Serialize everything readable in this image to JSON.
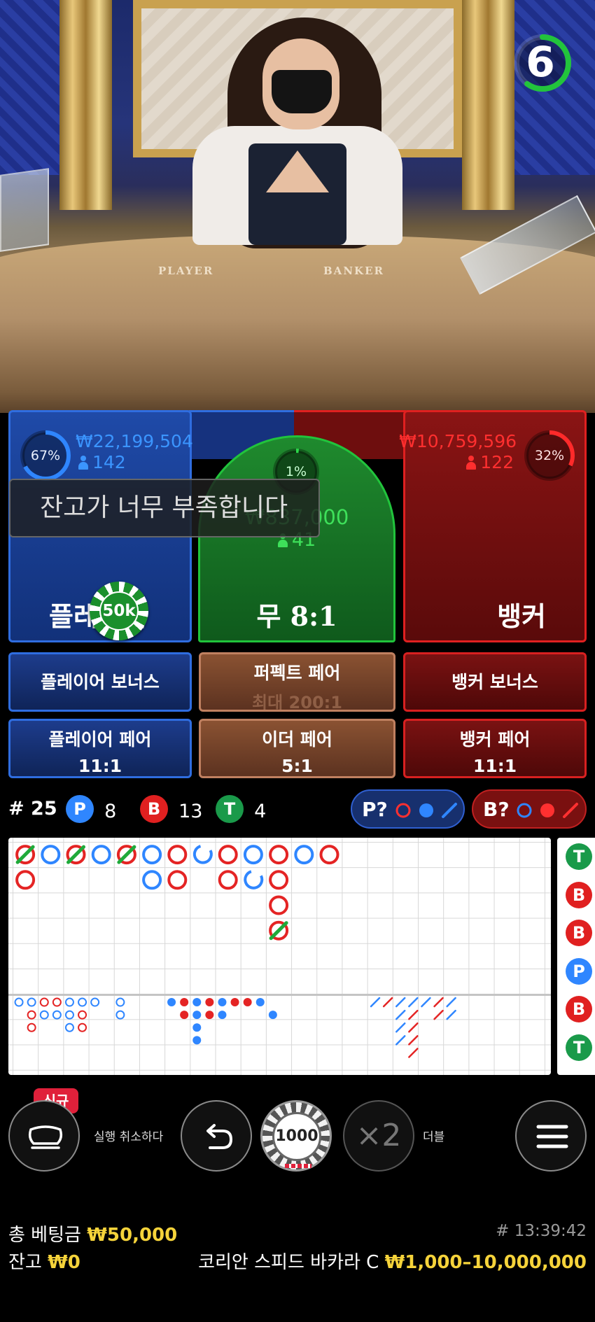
{
  "timer": {
    "seconds": "6",
    "progress": 0.6,
    "color": "#22c43c"
  },
  "table_words": {
    "player": "PLAYER",
    "banker": "BANKER"
  },
  "player": {
    "percent": "67%",
    "percent_value": 0.67,
    "amount": "₩22,199,504",
    "count": "142",
    "label": "플레이어",
    "color": "#2f86ff"
  },
  "banker": {
    "percent": "32%",
    "percent_value": 0.32,
    "amount": "₩10,759,596",
    "count": "122",
    "label": "뱅커",
    "color": "#ff2a2a"
  },
  "tie": {
    "percent": "1%",
    "percent_value": 0.01,
    "amount": "₩837,000",
    "count": "41",
    "label": "무 8:1",
    "color": "#2cd84a"
  },
  "toast": "잔고가 너무 부족합니다",
  "placed_chip": "50k",
  "side_bets": {
    "player_bonus": "플레이어 보너스",
    "perfect_pair": "퍼펙트 페어",
    "perfect_pair_payout": "최대 200:1",
    "banker_bonus": "뱅커 보너스",
    "player_pair": "플레이어 페어",
    "player_pair_payout": "11:1",
    "either_pair": "이더 페어",
    "either_pair_payout": "5:1",
    "banker_pair": "뱅커 페어",
    "banker_pair_payout": "11:1"
  },
  "stats": {
    "round_prefix": "#",
    "round": "25",
    "p_badge": "P",
    "p_count": "8",
    "b_badge": "B",
    "b_count": "13",
    "t_badge": "T",
    "t_count": "4",
    "p_ask": "P?",
    "b_ask": "B?"
  },
  "roadmap": {
    "big_road": [
      {
        "c": 0,
        "r": 0,
        "side": "B",
        "tie": true
      },
      {
        "c": 1,
        "r": 0,
        "side": "P"
      },
      {
        "c": 2,
        "r": 0,
        "side": "B",
        "tie": true
      },
      {
        "c": 3,
        "r": 0,
        "side": "P"
      },
      {
        "c": 4,
        "r": 0,
        "side": "B",
        "tie": true
      },
      {
        "c": 5,
        "r": 0,
        "side": "P"
      },
      {
        "c": 6,
        "r": 0,
        "side": "B"
      },
      {
        "c": 7,
        "r": 0,
        "side": "P",
        "partial": true
      },
      {
        "c": 8,
        "r": 0,
        "side": "B"
      },
      {
        "c": 9,
        "r": 0,
        "side": "P"
      },
      {
        "c": 10,
        "r": 0,
        "side": "B"
      },
      {
        "c": 11,
        "r": 0,
        "side": "P"
      },
      {
        "c": 12,
        "r": 0,
        "side": "B"
      },
      {
        "c": 0,
        "r": 1,
        "side": "B"
      },
      {
        "c": 5,
        "r": 1,
        "side": "P"
      },
      {
        "c": 6,
        "r": 1,
        "side": "B"
      },
      {
        "c": 8,
        "r": 1,
        "side": "B"
      },
      {
        "c": 9,
        "r": 1,
        "side": "P",
        "partial": true
      },
      {
        "c": 10,
        "r": 1,
        "side": "B"
      },
      {
        "c": 10,
        "r": 2,
        "side": "B"
      },
      {
        "c": 10,
        "r": 3,
        "side": "B",
        "tie": true
      }
    ],
    "big_eye": [
      {
        "c": 0,
        "r": 0,
        "s": "P"
      },
      {
        "c": 1,
        "r": 0,
        "s": "P"
      },
      {
        "c": 2,
        "r": 0,
        "s": "B"
      },
      {
        "c": 3,
        "r": 0,
        "s": "B"
      },
      {
        "c": 4,
        "r": 0,
        "s": "P"
      },
      {
        "c": 5,
        "r": 0,
        "s": "P"
      },
      {
        "c": 6,
        "r": 0,
        "s": "P"
      },
      {
        "c": 8,
        "r": 0,
        "s": "P"
      },
      {
        "c": 1,
        "r": 1,
        "s": "B"
      },
      {
        "c": 2,
        "r": 1,
        "s": "P"
      },
      {
        "c": 3,
        "r": 1,
        "s": "P"
      },
      {
        "c": 4,
        "r": 1,
        "s": "P"
      },
      {
        "c": 5,
        "r": 1,
        "s": "B"
      },
      {
        "c": 8,
        "r": 1,
        "s": "P"
      },
      {
        "c": 1,
        "r": 2,
        "s": "B"
      },
      {
        "c": 4,
        "r": 2,
        "s": "P"
      },
      {
        "c": 5,
        "r": 2,
        "s": "B"
      }
    ],
    "small_road": [
      {
        "c": 0,
        "r": 0,
        "s": "P"
      },
      {
        "c": 1,
        "r": 0,
        "s": "B"
      },
      {
        "c": 2,
        "r": 0,
        "s": "P"
      },
      {
        "c": 3,
        "r": 0,
        "s": "B"
      },
      {
        "c": 4,
        "r": 0,
        "s": "P"
      },
      {
        "c": 5,
        "r": 0,
        "s": "B"
      },
      {
        "c": 6,
        "r": 0,
        "s": "B"
      },
      {
        "c": 7,
        "r": 0,
        "s": "P"
      },
      {
        "c": 1,
        "r": 1,
        "s": "B"
      },
      {
        "c": 2,
        "r": 1,
        "s": "P"
      },
      {
        "c": 3,
        "r": 1,
        "s": "B"
      },
      {
        "c": 4,
        "r": 1,
        "s": "P"
      },
      {
        "c": 8,
        "r": 1,
        "s": "P"
      },
      {
        "c": 2,
        "r": 2,
        "s": "P"
      },
      {
        "c": 2,
        "r": 3,
        "s": "P"
      }
    ],
    "cockroach": [
      {
        "c": 0,
        "r": 0,
        "s": "P"
      },
      {
        "c": 1,
        "r": 0,
        "s": "B"
      },
      {
        "c": 2,
        "r": 0,
        "s": "P"
      },
      {
        "c": 3,
        "r": 0,
        "s": "P"
      },
      {
        "c": 4,
        "r": 0,
        "s": "P"
      },
      {
        "c": 5,
        "r": 0,
        "s": "B"
      },
      {
        "c": 6,
        "r": 0,
        "s": "P"
      },
      {
        "c": 2,
        "r": 1,
        "s": "P"
      },
      {
        "c": 3,
        "r": 1,
        "s": "B"
      },
      {
        "c": 5,
        "r": 1,
        "s": "B"
      },
      {
        "c": 6,
        "r": 1,
        "s": "P"
      },
      {
        "c": 2,
        "r": 2,
        "s": "P"
      },
      {
        "c": 3,
        "r": 2,
        "s": "B"
      },
      {
        "c": 2,
        "r": 3,
        "s": "P"
      },
      {
        "c": 3,
        "r": 3,
        "s": "B"
      },
      {
        "c": 3,
        "r": 4,
        "s": "B"
      }
    ],
    "bead_column": [
      "T",
      "B",
      "B",
      "P",
      "B",
      "T"
    ]
  },
  "controls": {
    "new_badge": "신규",
    "undo_label": "실행 취소하다",
    "chip_value": "1000",
    "double_symbol": "×2",
    "double_label": "더블"
  },
  "footer": {
    "total_bet_label": "총 베팅금",
    "total_bet": "₩50,000",
    "balance_label": "잔고",
    "balance": "₩0",
    "time": "# 13:39:42",
    "table_name": "코리안 스피드 바카라 C",
    "limits": "₩1,000–10,000,000"
  },
  "colors": {
    "player_blue": "#2f86ff",
    "banker_red": "#e02020",
    "tie_green": "#1fae36",
    "gold": "#f5d33a"
  }
}
